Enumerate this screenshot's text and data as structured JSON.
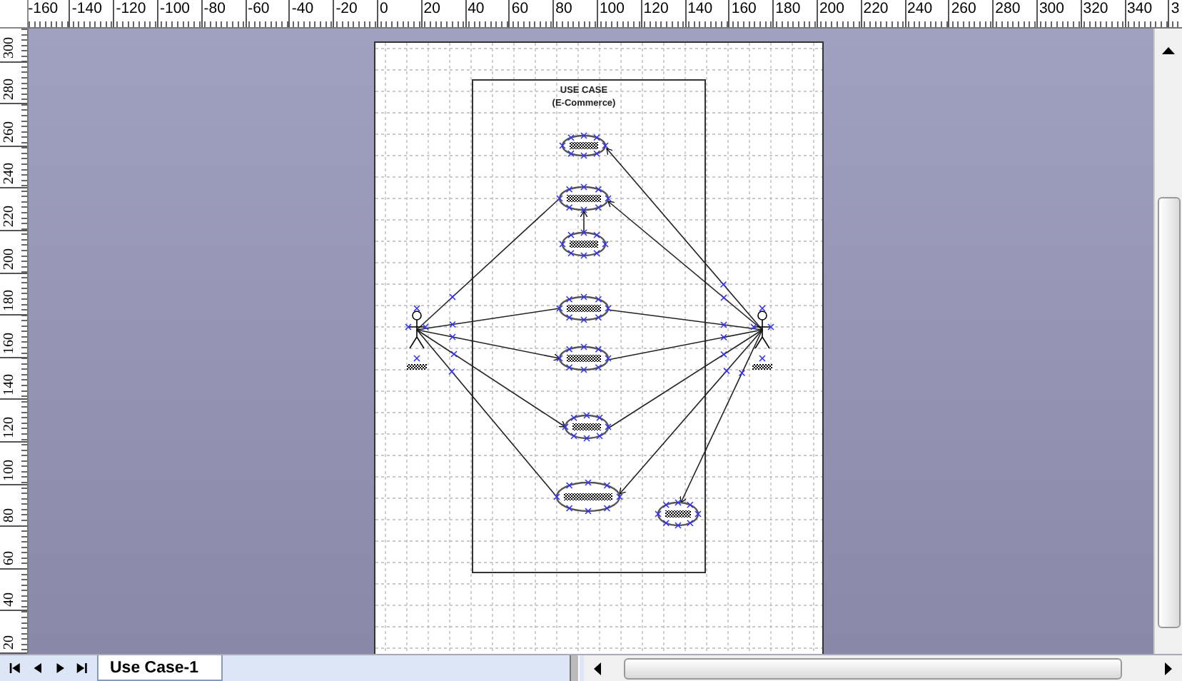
{
  "ruler_top": {
    "labels": [
      "-160",
      "-140",
      "-120",
      "-100",
      "-80",
      "-60",
      "-40",
      "-20",
      "0",
      "20",
      "40",
      "60",
      "80",
      "100",
      "120",
      "140",
      "160",
      "180",
      "200",
      "220",
      "240",
      "260",
      "280",
      "300",
      "320",
      "340",
      "3"
    ]
  },
  "ruler_left": {
    "labels": [
      "300",
      "280",
      "260",
      "240",
      "220",
      "200",
      "180",
      "160",
      "140",
      "120",
      "100",
      "80",
      "60",
      "40",
      "20"
    ]
  },
  "diagram": {
    "title": "USE CASE",
    "subtitle": "(E-Commerce)"
  },
  "page_tabs": [
    {
      "label": "Use Case-1",
      "selected": true
    }
  ]
}
